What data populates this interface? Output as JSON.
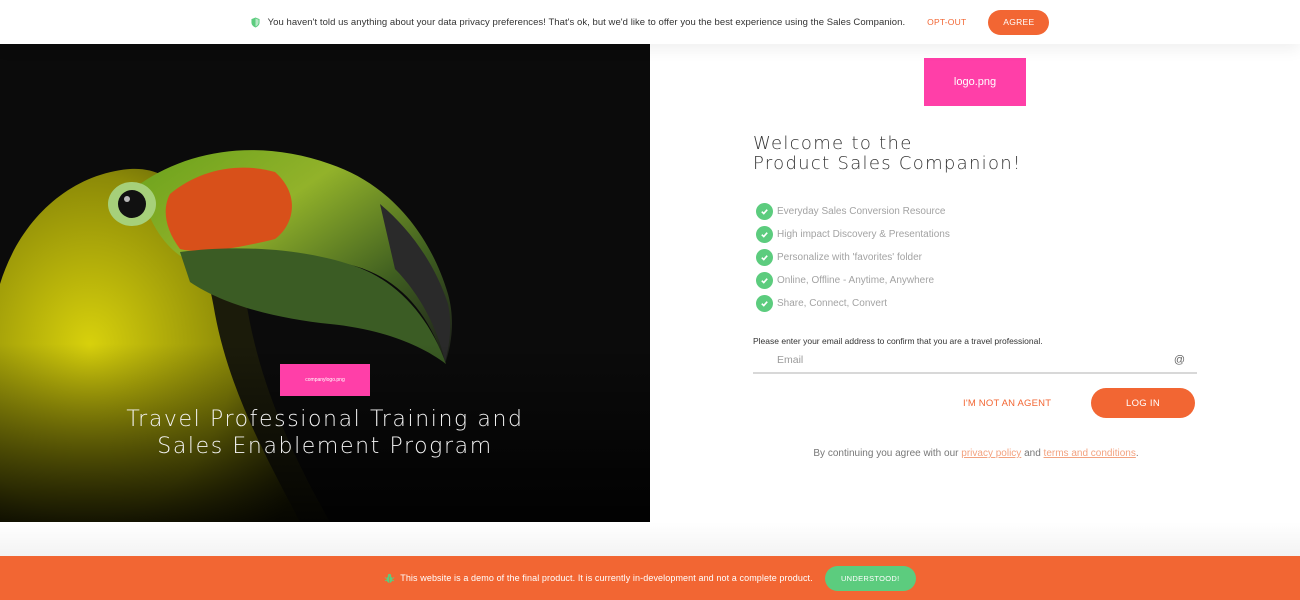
{
  "privacy_banner": {
    "message": "You haven't told us anything about your data privacy preferences! That's ok, but we'd like to offer you the best experience using the Sales Companion.",
    "opt_out_label": "OPT-OUT",
    "agree_label": "AGREE"
  },
  "hero": {
    "company_logo_text": "companylogo.png",
    "title": "Travel Professional Training and Sales Enablement Program"
  },
  "login": {
    "logo_text": "logo.png",
    "welcome_line1": "Welcome to the",
    "welcome_line2": "Product Sales Companion!",
    "features": [
      "Everyday Sales Conversion Resource",
      "High impact Discovery & Presentations",
      "Personalize with 'favorites' folder",
      "Online, Offline - Anytime, Anywhere",
      "Share, Connect, Convert"
    ],
    "prompt": "Please enter your email address to confirm that you are a travel professional.",
    "email_placeholder": "Email",
    "at_symbol": "@",
    "not_agent_label": "I'M NOT AN AGENT",
    "login_label": "LOG IN",
    "agree_prefix": "By continuing you agree with our",
    "privacy_policy_label": "privacy policy",
    "and_text": "and",
    "terms_label": "terms and conditions",
    "agree_suffix": "."
  },
  "demo_banner": {
    "message": "This website is a demo of the final product. It is currently in-development and not a complete product.",
    "understood_label": "UNDERSTOOD!"
  },
  "colors": {
    "accent": "#f26633",
    "success": "#5ccc7e",
    "placeholder_logo": "#ff3fa8",
    "hero_bg": "#0b0b0b"
  },
  "icons": {
    "privacy": "shield-icon",
    "feature": "check-circle-icon",
    "email": "at-sign-icon",
    "demo": "bug-icon"
  }
}
